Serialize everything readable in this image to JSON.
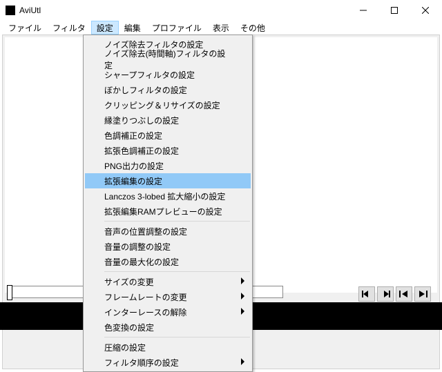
{
  "window": {
    "title": "AviUtl"
  },
  "menubar": {
    "items": [
      {
        "label": "ファイル"
      },
      {
        "label": "フィルタ"
      },
      {
        "label": "設定"
      },
      {
        "label": "編集"
      },
      {
        "label": "プロファイル"
      },
      {
        "label": "表示"
      },
      {
        "label": "その他"
      }
    ],
    "active_index": 2
  },
  "dropdown": {
    "groups": [
      [
        {
          "label": "ノイズ除去フィルタの設定",
          "submenu": false
        },
        {
          "label": "ノイズ除去(時間軸)フィルタの設定",
          "submenu": false
        },
        {
          "label": "シャープフィルタの設定",
          "submenu": false
        },
        {
          "label": "ぼかしフィルタの設定",
          "submenu": false
        },
        {
          "label": "クリッピング＆リサイズの設定",
          "submenu": false
        },
        {
          "label": "縁塗りつぶしの設定",
          "submenu": false
        },
        {
          "label": "色調補正の設定",
          "submenu": false
        },
        {
          "label": "拡張色調補正の設定",
          "submenu": false
        },
        {
          "label": "PNG出力の設定",
          "submenu": false
        },
        {
          "label": "拡張編集の設定",
          "submenu": false,
          "highlight": true
        },
        {
          "label": "Lanczos 3-lobed 拡大縮小の設定",
          "submenu": false
        },
        {
          "label": "拡張編集RAMプレビューの設定",
          "submenu": false
        }
      ],
      [
        {
          "label": "音声の位置調整の設定",
          "submenu": false
        },
        {
          "label": "音量の調整の設定",
          "submenu": false
        },
        {
          "label": "音量の最大化の設定",
          "submenu": false
        }
      ],
      [
        {
          "label": "サイズの変更",
          "submenu": true
        },
        {
          "label": "フレームレートの変更",
          "submenu": true
        },
        {
          "label": "インターレースの解除",
          "submenu": true
        },
        {
          "label": "色変換の設定",
          "submenu": false
        }
      ],
      [
        {
          "label": "圧縮の設定",
          "submenu": false
        },
        {
          "label": "フィルタ順序の設定",
          "submenu": true
        }
      ]
    ]
  },
  "transport": {
    "buttons": [
      "prev-frame",
      "next-frame",
      "go-start",
      "go-end"
    ]
  }
}
